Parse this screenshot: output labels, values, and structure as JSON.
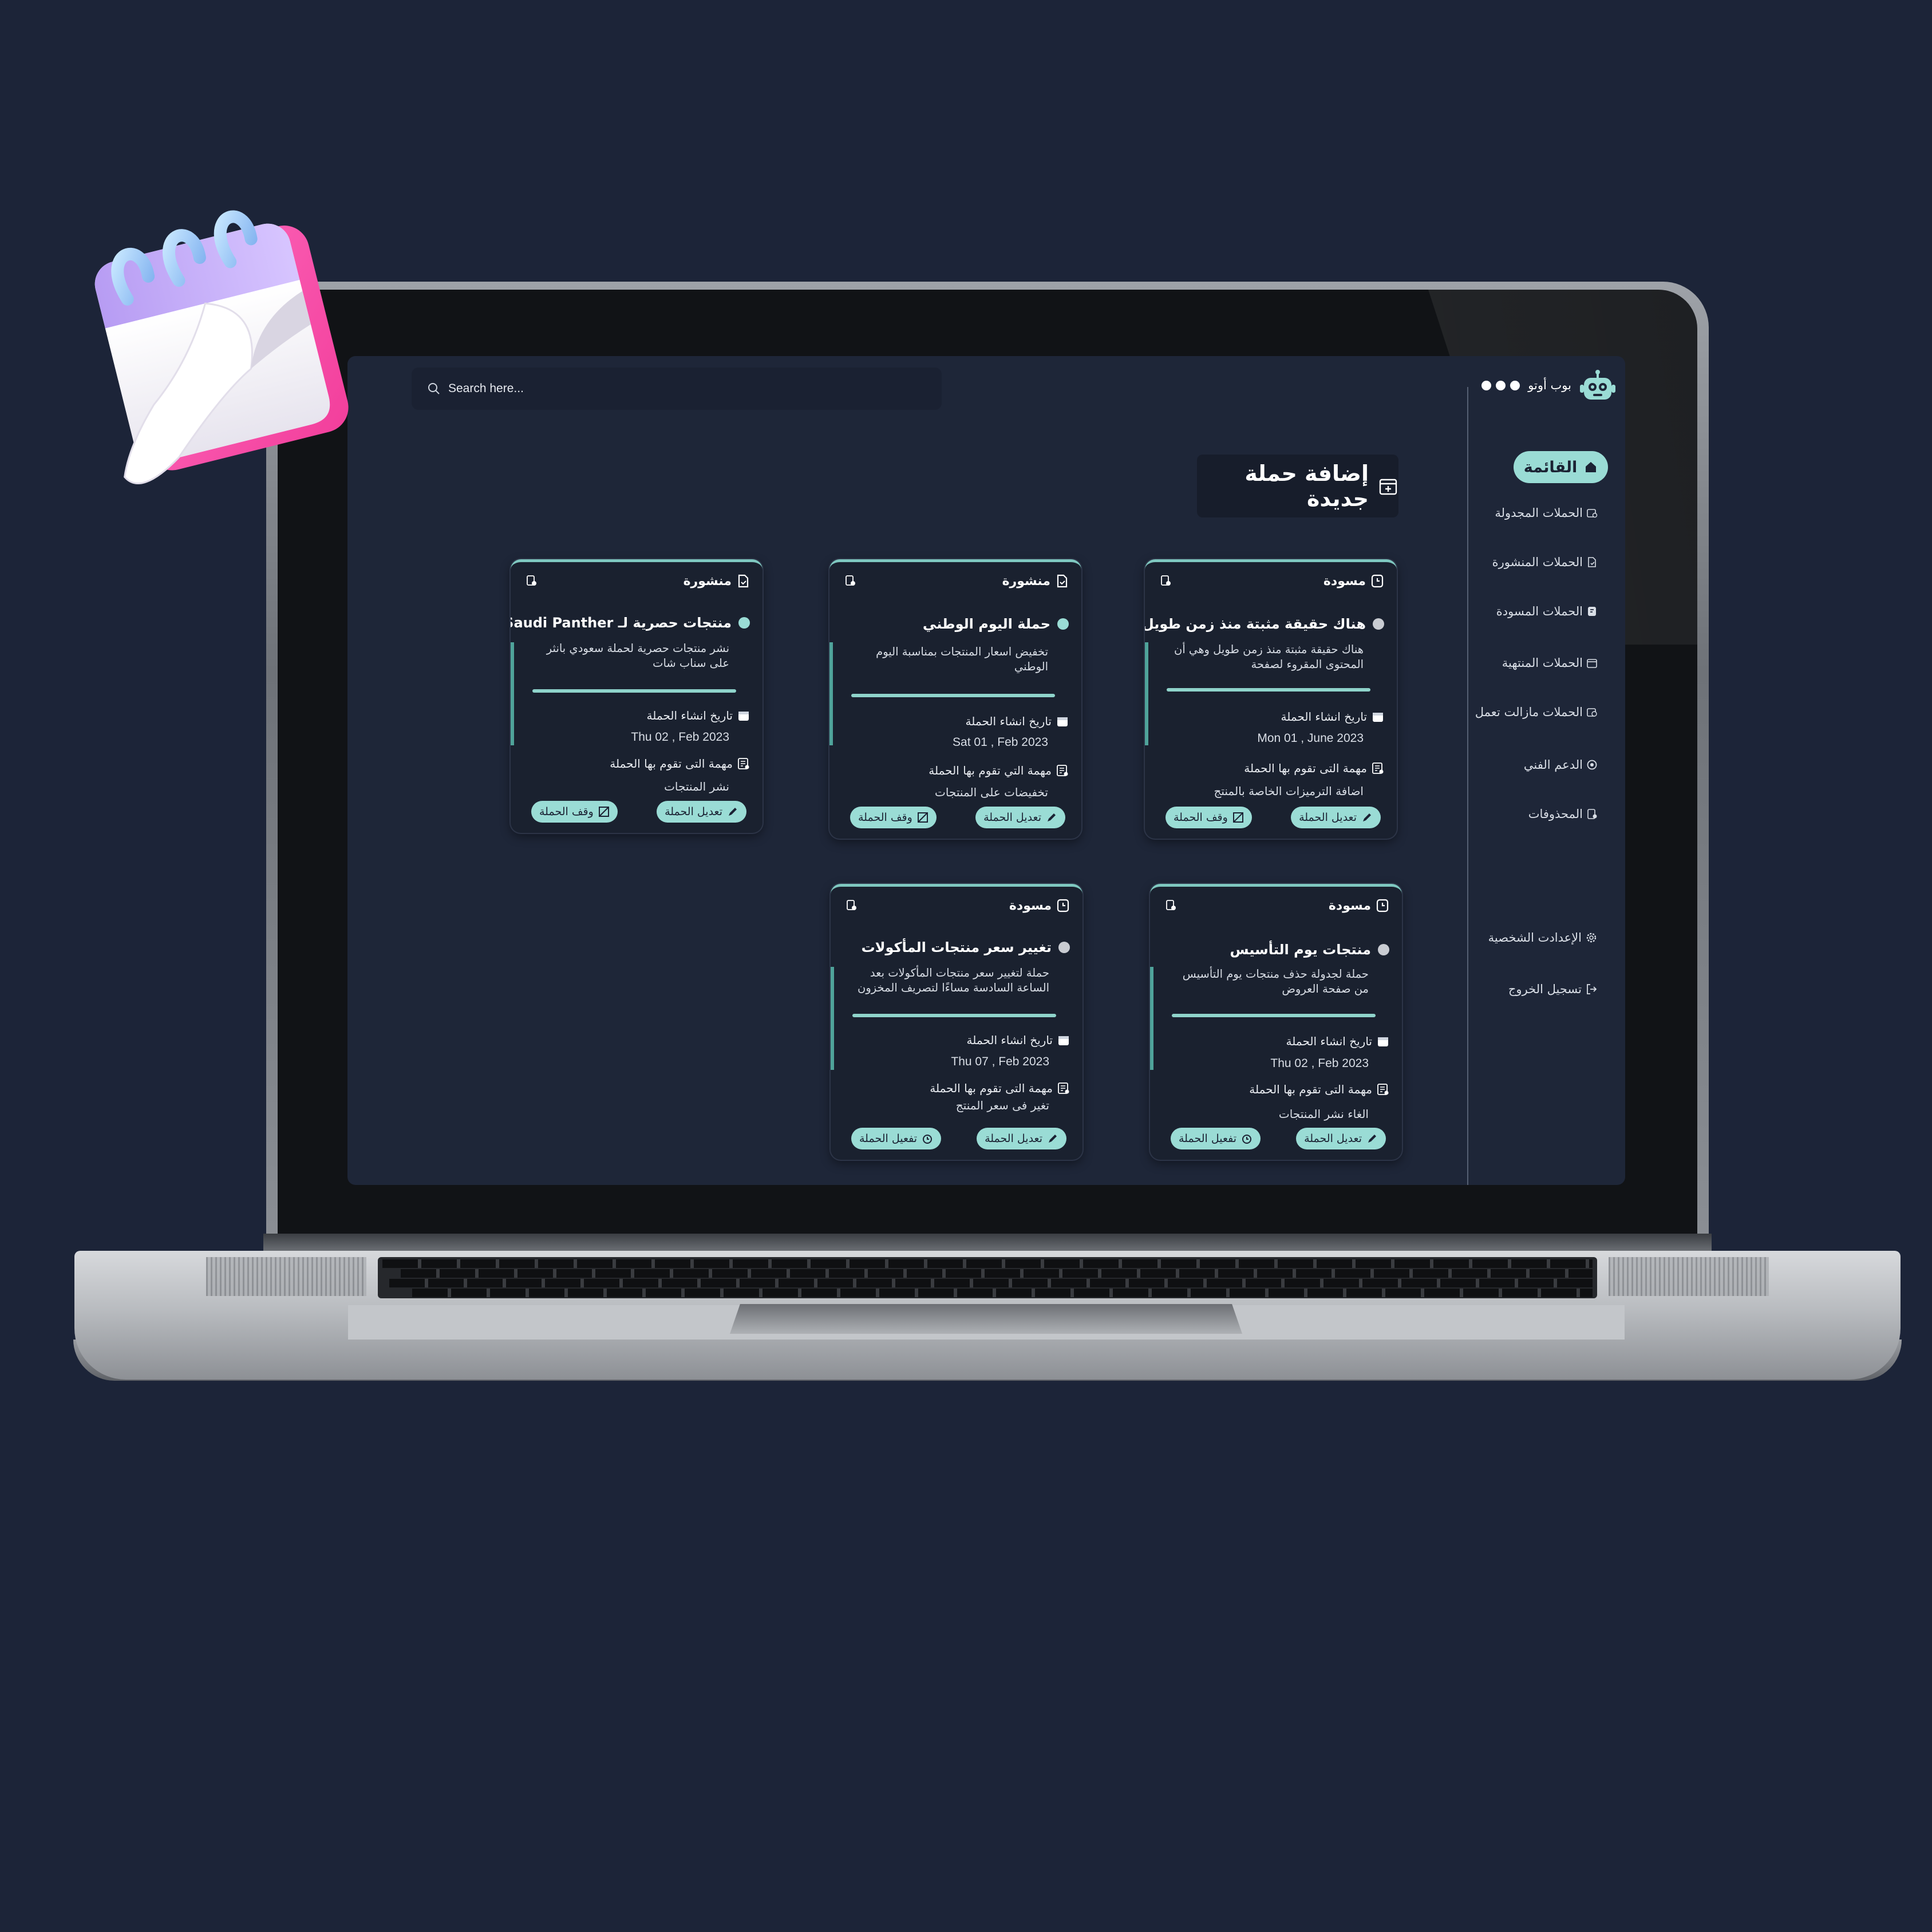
{
  "app": {
    "name": "بوب أوتو"
  },
  "search": {
    "placeholder": "Search here..."
  },
  "nav": {
    "menu_label": "القائمة",
    "items": [
      {
        "label": "الحملات المجدولة",
        "icon": "calendar-clock-icon"
      },
      {
        "label": "الحملات المنشورة",
        "icon": "document-published-icon"
      },
      {
        "label": "الحملات المسودة",
        "icon": "draft-icon"
      },
      {
        "label": "الحملات المنتهية",
        "icon": "calendar-check-icon"
      },
      {
        "label": "الحملات مازالت تعمل",
        "icon": "running-icon"
      },
      {
        "label": "الدعم الفني",
        "icon": "support-icon"
      },
      {
        "label": "المحذوفات",
        "icon": "trash-doc-icon"
      },
      {
        "label": "الإعدادت الشخصية",
        "icon": "gear-icon"
      },
      {
        "label": "تسجيل الخروج",
        "icon": "logout-icon"
      }
    ]
  },
  "main": {
    "add_campaign_label": "إضافة حملة جديدة",
    "meta_labels": {
      "created": "تاريخ انشاء الحملة",
      "task": "مهمة التى تقوم بها الحملة",
      "task_alt": "مهمة التي تقوم بها الحملة"
    },
    "cards": [
      {
        "status": "مسودة",
        "title": "هناك حقيقة مثبتة منذ زمن طويل",
        "desc": "هناك حقيقة مثبتة منذ زمن طويل وهي أن المحتوى المقروء لصفحة",
        "date": "Mon 01 , June 2023",
        "task_label": "مهمة التى تقوم بها الحملة",
        "task": "اضافة الترميزات الخاصة بالمنتج",
        "edit": "تعديل الحملة",
        "toggle": "وقف الحملة"
      },
      {
        "status": "منشورة",
        "title": "حملة اليوم الوطني",
        "desc": "تخفيض اسعار المنتجات بمناسبة اليوم الوطني",
        "date": "Sat 01 , Feb 2023",
        "task_label": "مهمة التي تقوم بها الحملة",
        "task": "تخفيضات على المنتجات",
        "edit": "تعديل الحملة",
        "toggle": "وقف الحملة"
      },
      {
        "status": "منشورة",
        "title": "منتجات حصرية لـ Saudi Panther",
        "desc": "نشر منتجات حصرية لحملة سعودي بانثر على سناب شات",
        "date": "Thu 02 , Feb 2023",
        "task_label": "مهمة التى تقوم بها الحملة",
        "task": "نشر المنتجات",
        "edit": "تعديل الحملة",
        "toggle": "وقف الحملة"
      },
      {
        "status": "مسودة",
        "title": "منتجات يوم التأسيس",
        "desc": "حملة لجدولة حذف منتجات يوم التأسيس من صفحة العروض",
        "date": "Thu 02 , Feb 2023",
        "task_label": "مهمة التى تقوم بها الحملة",
        "task": "الغاء نشر المنتجات",
        "edit": "تعديل الحملة",
        "toggle": "تفعيل الحملة"
      },
      {
        "status": "مسودة",
        "title": "تغيير سعر منتجات المأكولات",
        "desc": "حملة لتغيير سعر منتجات المأكولات بعد الساعة السادسة مساءًا لتصريف المخزون",
        "date": "Thu 07 , Feb 2023",
        "task_label": "مهمة التى تقوم بها الحملة",
        "task": "تغير فى سعر المنتج",
        "edit": "تعديل الحملة",
        "toggle": "تفعيل الحملة"
      }
    ]
  },
  "colors": {
    "accent": "#9adcd5",
    "panel": "#1e2638",
    "card": "#1a212f",
    "background": "#1c2438",
    "draft_dot": "#c9ccd2",
    "published_dot": "#9adcd5"
  }
}
